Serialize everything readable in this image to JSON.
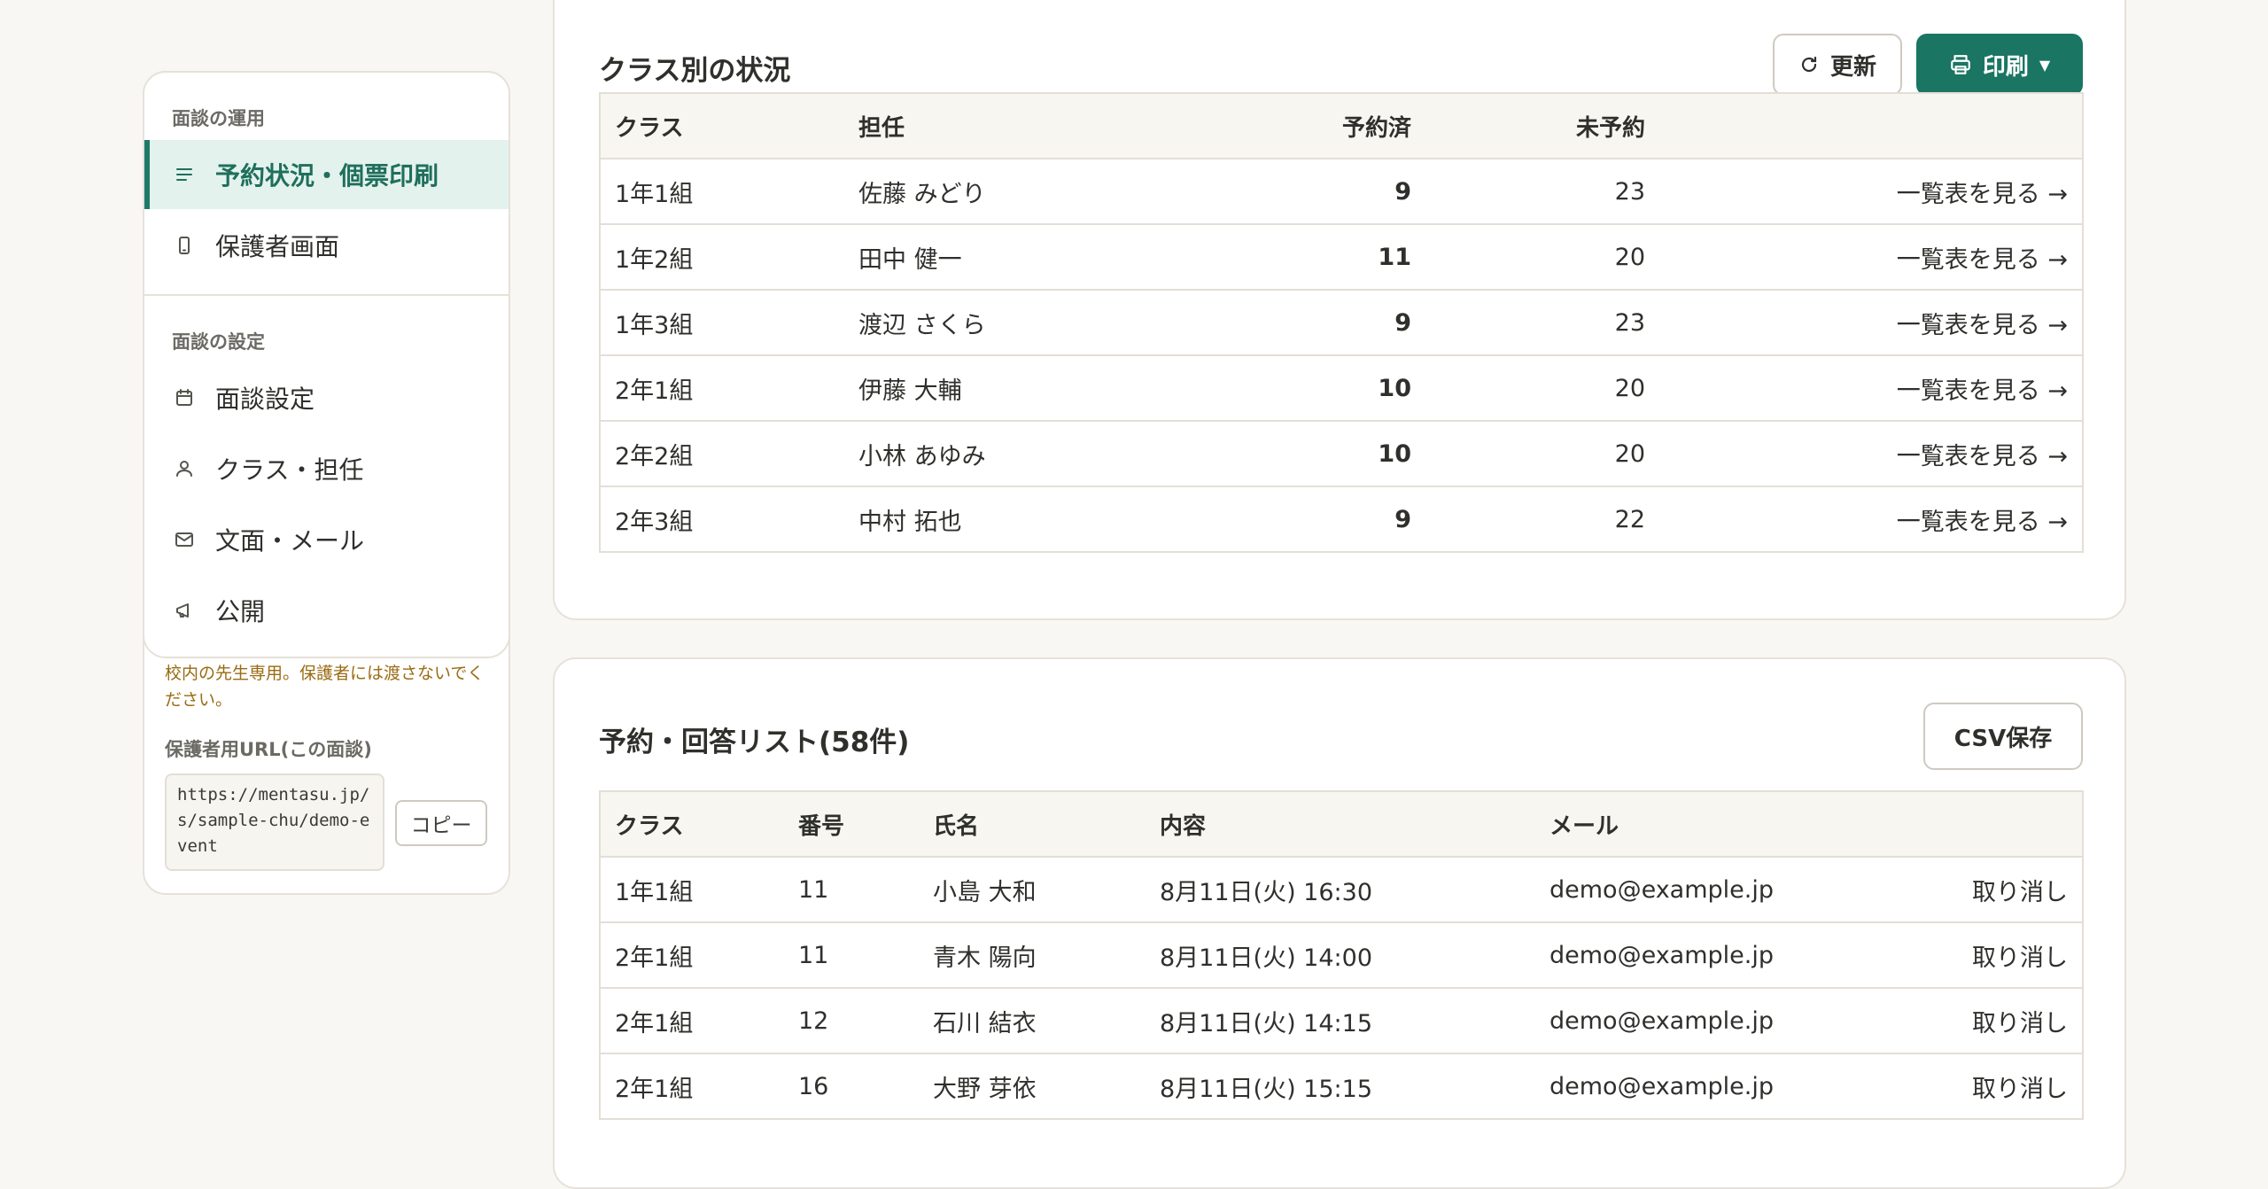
{
  "sidebar": {
    "section1": "面談の運用",
    "section2": "面談の設定",
    "items": [
      {
        "label": "予約状況・個票印刷",
        "icon": "list-icon",
        "active": true
      },
      {
        "label": "保護者画面",
        "icon": "smartphone-icon",
        "active": false
      },
      {
        "label": "面談設定",
        "icon": "calendar-icon",
        "active": false
      },
      {
        "label": "クラス・担任",
        "icon": "user-icon",
        "active": false
      },
      {
        "label": "文面・メール",
        "icon": "mail-icon",
        "active": false
      },
      {
        "label": "公開",
        "icon": "megaphone-icon",
        "active": false
      }
    ],
    "notice": "校内の先生専用。保護者には渡さないでください。",
    "url_label": "保護者用URL(この面談)",
    "url_value": "https://mentasu.jp/s/sample-chu/demo-event",
    "copy_label": "コピー"
  },
  "class_status": {
    "title": "クラス別の状況",
    "refresh_label": "更新",
    "print_label": "印刷",
    "columns": [
      "クラス",
      "担任",
      "予約済",
      "未予約",
      ""
    ],
    "rows": [
      {
        "class": "1年1組",
        "teacher": "佐藤 みどり",
        "reserved": "9",
        "unreserved": "23",
        "link": "一覧表を見る →"
      },
      {
        "class": "1年2組",
        "teacher": "田中 健一",
        "reserved": "11",
        "unreserved": "20",
        "link": "一覧表を見る →"
      },
      {
        "class": "1年3組",
        "teacher": "渡辺 さくら",
        "reserved": "9",
        "unreserved": "23",
        "link": "一覧表を見る →"
      },
      {
        "class": "2年1組",
        "teacher": "伊藤 大輔",
        "reserved": "10",
        "unreserved": "20",
        "link": "一覧表を見る →"
      },
      {
        "class": "2年2組",
        "teacher": "小林 あゆみ",
        "reserved": "10",
        "unreserved": "20",
        "link": "一覧表を見る →"
      },
      {
        "class": "2年3組",
        "teacher": "中村 拓也",
        "reserved": "9",
        "unreserved": "22",
        "link": "一覧表を見る →"
      }
    ]
  },
  "reservations": {
    "title": "予約・回答リスト(58件)",
    "csv_label": "CSV保存",
    "columns": [
      "クラス",
      "番号",
      "氏名",
      "内容",
      "メール",
      ""
    ],
    "rows": [
      {
        "class": "1年1組",
        "number": "11",
        "name": "小島 大和",
        "content": "8月11日(火) 16:30",
        "email": "demo@example.jp",
        "action": "取り消し"
      },
      {
        "class": "2年1組",
        "number": "11",
        "name": "青木 陽向",
        "content": "8月11日(火) 14:00",
        "email": "demo@example.jp",
        "action": "取り消し"
      },
      {
        "class": "2年1組",
        "number": "12",
        "name": "石川 結衣",
        "content": "8月11日(火) 14:15",
        "email": "demo@example.jp",
        "action": "取り消し"
      },
      {
        "class": "2年1組",
        "number": "16",
        "name": "大野 芽依",
        "content": "8月11日(火) 15:15",
        "email": "demo@example.jp",
        "action": "取り消し"
      }
    ]
  }
}
